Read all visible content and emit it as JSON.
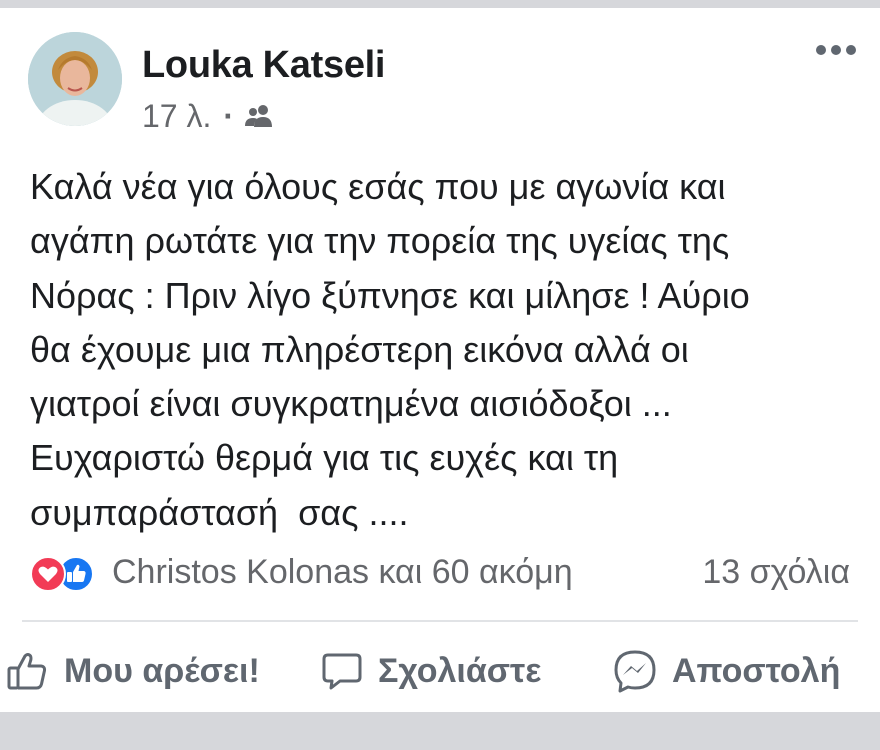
{
  "post": {
    "author": "Louka Katseli",
    "time": "17 λ.",
    "separator": "·",
    "privacy_icon": "friends-icon",
    "lines": [
      "Καλά νέα για όλους εσάς που με αγωνία και",
      "αγάπη ρωτάτε για την πορεία της υγείας της",
      "Νόρας : Πριν λίγο ξύπνησε και μίλησε ! Αύριο",
      "θα έχουμε μια πληρέστερη εικόνα αλλά οι",
      "γιατροί είναι συγκρατημένα αισιόδοξοι ...",
      "Ευχαριστώ θερμά για τις ευχές και τη",
      "συμπαράστασή  σας ...."
    ]
  },
  "reactions": {
    "icons": [
      "heart-icon",
      "like-icon"
    ],
    "text": "Christos Kolonas και 60 ακόμη",
    "comments": "13 σχόλια"
  },
  "actions": {
    "like": "Μου αρέσει!",
    "comment": "Σχολιάστε",
    "send": "Αποστολή"
  },
  "colors": {
    "text": "#1c1e21",
    "secondary": "#65676b",
    "heart": "#f23b56",
    "like": "#1877f2",
    "band": "#d6d7db"
  }
}
